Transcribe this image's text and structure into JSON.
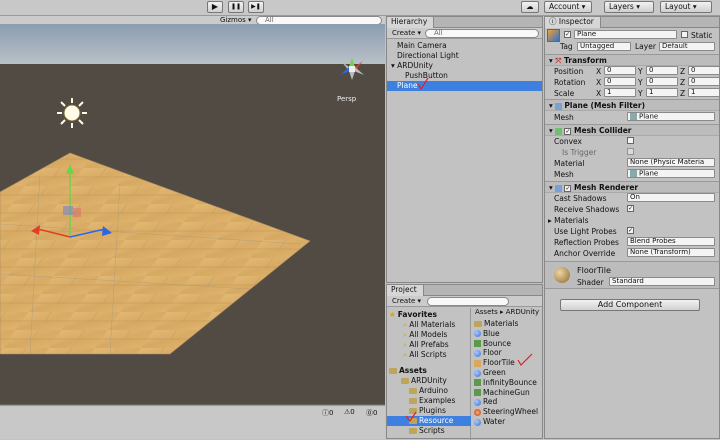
{
  "toolbar": {
    "play": "▶",
    "pause": "❚❚",
    "step": "▶❚",
    "cloud": "☁",
    "account": "Account",
    "layers": "Layers",
    "layout": "Layout"
  },
  "scene": {
    "gizmos": "Gizmos",
    "search": "All",
    "persp": "Persp"
  },
  "hierarchy": {
    "tab": "Hierarchy",
    "create": "Create",
    "search": "All",
    "items": [
      {
        "label": "Main Camera",
        "indent": 0
      },
      {
        "label": "Directional Light",
        "indent": 0
      },
      {
        "label": "ARDUnity",
        "indent": 0,
        "expanded": true
      },
      {
        "label": "PushButton",
        "indent": 1
      },
      {
        "label": "Plane",
        "indent": 0,
        "selected": true
      }
    ]
  },
  "project": {
    "tab": "Project",
    "create": "Create",
    "search": "",
    "favorites": {
      "label": "Favorites",
      "items": [
        "All Materials",
        "All Models",
        "All Prefabs",
        "All Scripts"
      ]
    },
    "assets": {
      "label": "Assets",
      "tree": [
        {
          "label": "ARDUnity",
          "level": 1
        },
        {
          "label": "Arduino",
          "level": 2
        },
        {
          "label": "Examples",
          "level": 2
        },
        {
          "label": "Plugins",
          "level": 2
        },
        {
          "label": "Resource",
          "level": 2,
          "selected": true
        },
        {
          "label": "Scripts",
          "level": 2
        }
      ]
    },
    "breadcrumb": [
      "Assets",
      "ARDUnity",
      "Resource"
    ],
    "files": [
      {
        "label": "Materials",
        "kind": "folder"
      },
      {
        "label": "Blue",
        "kind": "material",
        "color": "#3a6fd0"
      },
      {
        "label": "Bounce",
        "kind": "physic"
      },
      {
        "label": "Floor",
        "kind": "material",
        "color": "#3a6fd0"
      },
      {
        "label": "FloorTile",
        "kind": "texture"
      },
      {
        "label": "Green",
        "kind": "material",
        "color": "#3a6fd0"
      },
      {
        "label": "InfinityBounce",
        "kind": "physic"
      },
      {
        "label": "MachineGun",
        "kind": "physic"
      },
      {
        "label": "Red",
        "kind": "material",
        "color": "#3a6fd0"
      },
      {
        "label": "SteeringWheel",
        "kind": "prefab"
      },
      {
        "label": "Water",
        "kind": "material",
        "color": "#3a6fd0"
      }
    ]
  },
  "inspector": {
    "tab": "Inspector",
    "name": "Plane",
    "static": "Static",
    "tag_label": "Tag",
    "tag": "Untagged",
    "layer_label": "Layer",
    "layer": "Default",
    "transform": {
      "title": "Transform",
      "position": "Position",
      "rotation": "Rotation",
      "scale": "Scale",
      "x": "X",
      "y": "Y",
      "z": "Z",
      "pos": [
        "0",
        "0",
        "0"
      ],
      "rot": [
        "0",
        "0",
        "0"
      ],
      "scl": [
        "1",
        "1",
        "1"
      ]
    },
    "mesh_filter": {
      "title": "Plane (Mesh Filter)",
      "mesh_label": "Mesh",
      "mesh": "Plane"
    },
    "mesh_collider": {
      "title": "Mesh Collider",
      "convex": "Convex",
      "is_trigger": "Is Trigger",
      "material_label": "Material",
      "material": "None (Physic Materia",
      "mesh_label": "Mesh",
      "mesh": "Plane"
    },
    "mesh_renderer": {
      "title": "Mesh Renderer",
      "cast_shadows": "Cast Shadows",
      "cast_value": "On",
      "receive_shadows": "Receive Shadows",
      "materials": "Materials",
      "light_probes": "Use Light Probes",
      "reflection_probes": "Reflection Probes",
      "reflection_value": "Blend Probes",
      "anchor": "Anchor Override",
      "anchor_value": "None (Transform)"
    },
    "material": {
      "name": "FloorTile",
      "shader_label": "Shader",
      "shader": "Standard"
    },
    "add_component": "Add Component"
  },
  "colors": {
    "accent": "#3d80df",
    "sky_top": "#8d9fb3",
    "ground": "#524b44",
    "annotation": "#e0202a"
  }
}
